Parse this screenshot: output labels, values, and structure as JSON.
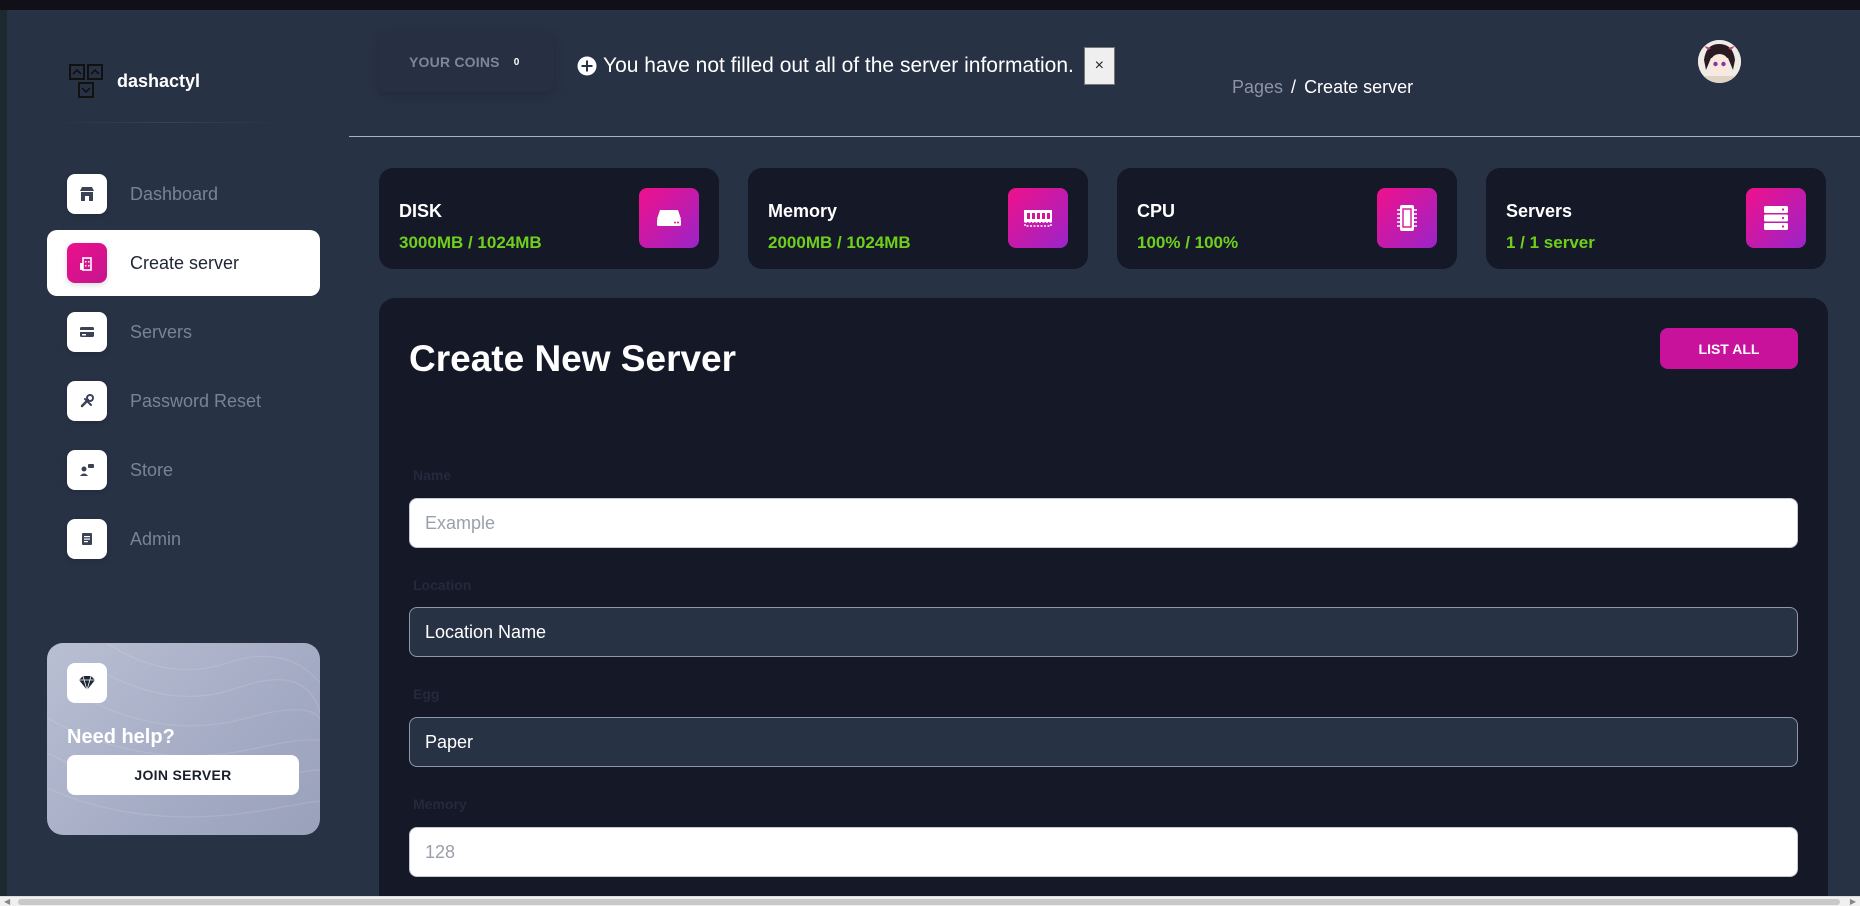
{
  "brand": {
    "name": "dashactyl"
  },
  "sidebar": {
    "items": [
      {
        "label": "Dashboard",
        "icon": "store-icon",
        "active": false
      },
      {
        "label": "Create server",
        "icon": "building-icon",
        "active": true
      },
      {
        "label": "Servers",
        "icon": "credit-card-icon",
        "active": false
      },
      {
        "label": "Password Reset",
        "icon": "wrench-icon",
        "active": false
      },
      {
        "label": "Store",
        "icon": "user-chat-icon",
        "active": false
      },
      {
        "label": "Admin",
        "icon": "document-icon",
        "active": false
      }
    ],
    "help": {
      "title": "Need help?",
      "button": "JOIN SERVER",
      "icon": "diamond-icon"
    }
  },
  "header": {
    "coins_label": "YOUR COINS",
    "coins_value": "0",
    "alert_text": "You have not filled out all of the server information.",
    "alert_close": "×",
    "breadcrumb": {
      "root": "Pages",
      "separator": "/",
      "current": "Create server"
    }
  },
  "stats": [
    {
      "title": "DISK",
      "value": "3000MB / 1024MB",
      "icon": "hard-drive-icon"
    },
    {
      "title": "Memory",
      "value": "2000MB / 1024MB",
      "icon": "memory-icon"
    },
    {
      "title": "CPU",
      "value": "100% / 100%",
      "icon": "cpu-icon"
    },
    {
      "title": "Servers",
      "value": "1 / 1 server",
      "icon": "server-icon"
    }
  ],
  "form": {
    "title": "Create New Server",
    "list_all": "LIST ALL",
    "fields": {
      "name": {
        "label": "Name",
        "placeholder": "Example",
        "value": ""
      },
      "location": {
        "label": "Location",
        "value": "Location Name"
      },
      "egg": {
        "label": "Egg",
        "value": "Paper"
      },
      "memory": {
        "label": "Memory",
        "placeholder": "128",
        "value": ""
      }
    }
  },
  "colors": {
    "accent": "#c9129c",
    "stat_value": "#6fcf1d",
    "sidebar_bg": "#283245",
    "card_bg": "#141827"
  }
}
